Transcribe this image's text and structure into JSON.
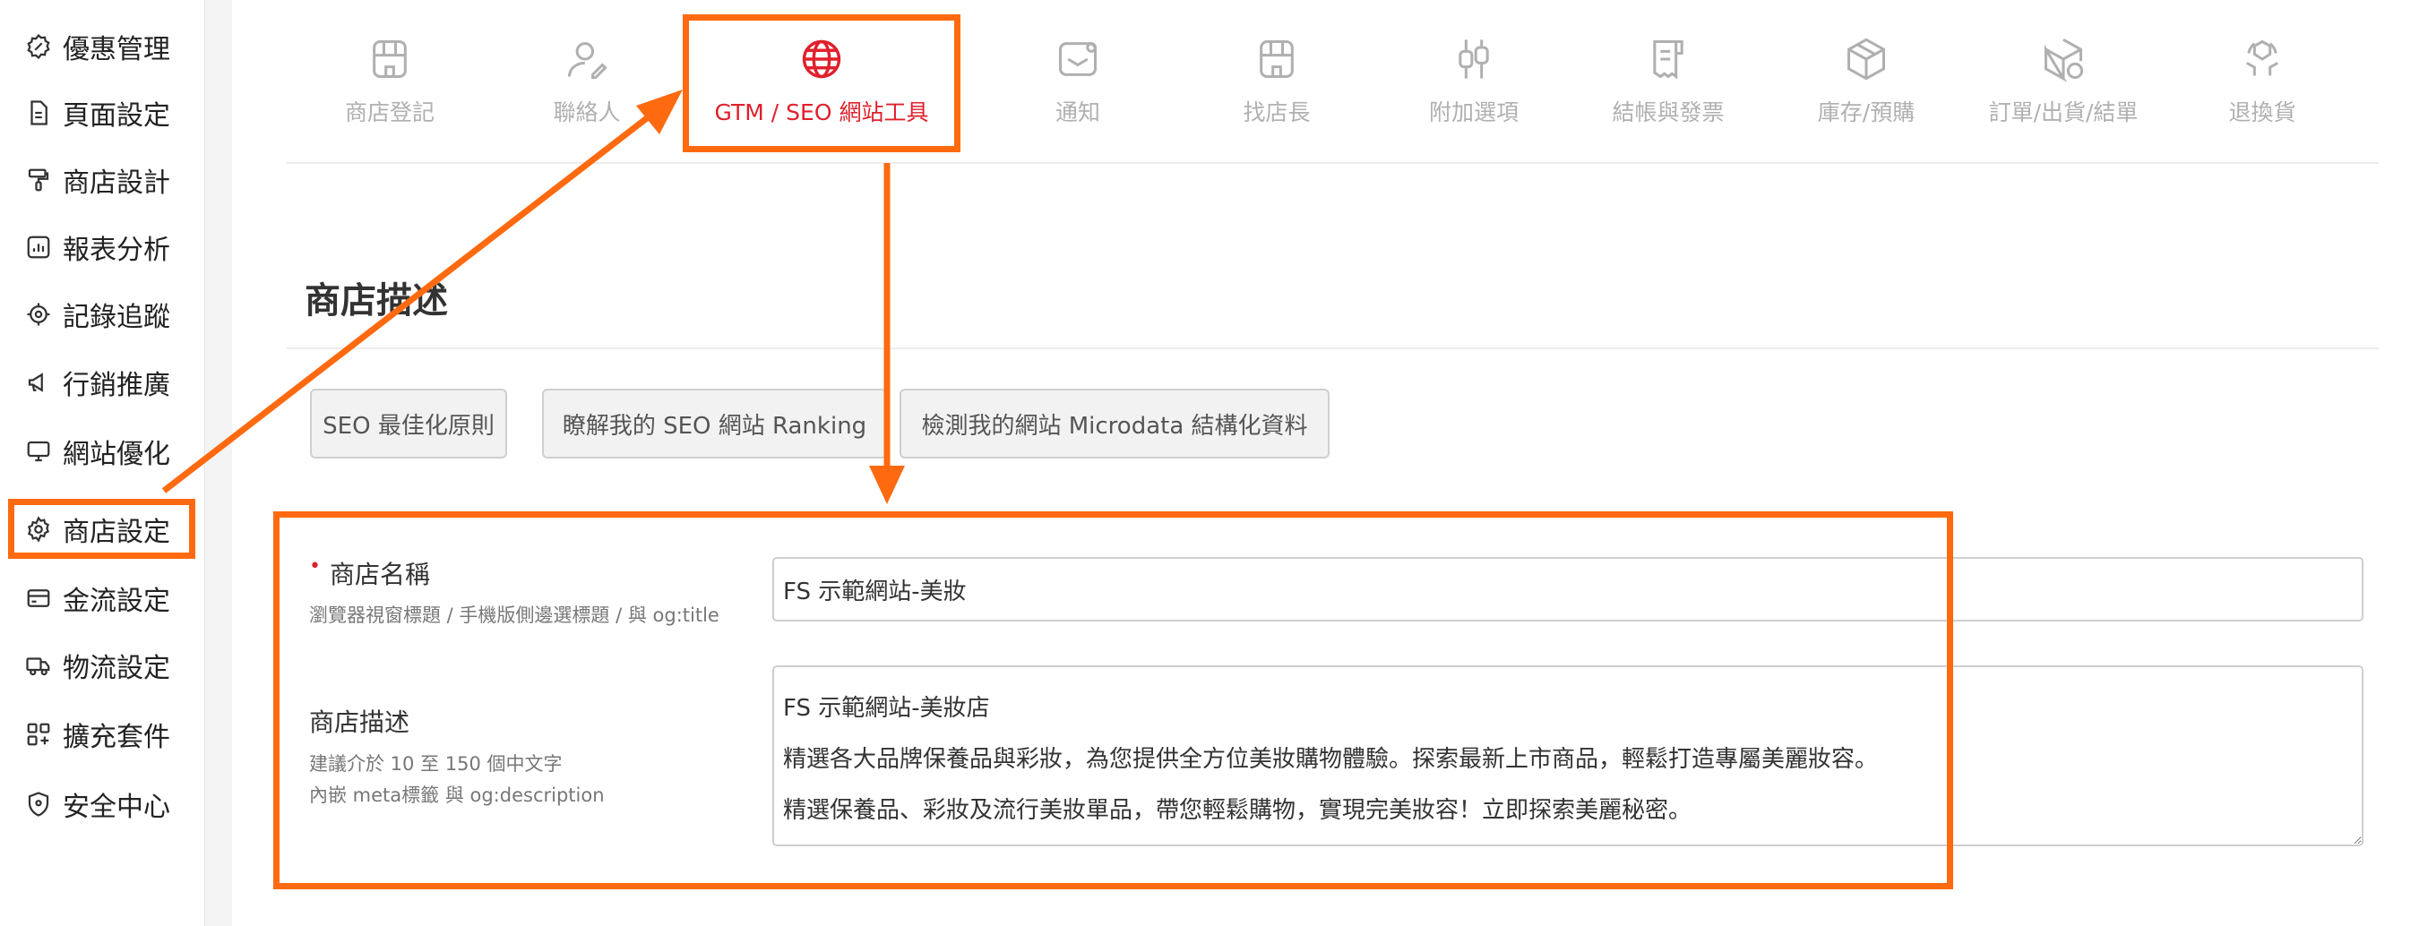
{
  "sidebar": {
    "items": [
      {
        "label": "優惠管理",
        "icon": "discount-badge-icon"
      },
      {
        "label": "頁面設定",
        "icon": "page-icon"
      },
      {
        "label": "商店設計",
        "icon": "paint-roller-icon"
      },
      {
        "label": "報表分析",
        "icon": "chart-icon"
      },
      {
        "label": "記錄追蹤",
        "icon": "target-icon"
      },
      {
        "label": "行銷推廣",
        "icon": "megaphone-icon"
      },
      {
        "label": "網站優化",
        "icon": "monitor-icon"
      },
      {
        "label": "商店設定",
        "icon": "gear-icon",
        "active": true
      },
      {
        "label": "金流設定",
        "icon": "card-icon"
      },
      {
        "label": "物流設定",
        "icon": "truck-icon"
      },
      {
        "label": "擴充套件",
        "icon": "apps-icon"
      },
      {
        "label": "安全中心",
        "icon": "shield-icon"
      }
    ]
  },
  "tabs": [
    {
      "label": "商店登記",
      "icon": "store-icon"
    },
    {
      "label": "聯絡人",
      "icon": "contact-icon"
    },
    {
      "label": "GTM / SEO 網站工具",
      "icon": "globe-icon",
      "active": true
    },
    {
      "label": "通知",
      "icon": "mail-notification-icon"
    },
    {
      "label": "找店長",
      "icon": "store-manager-icon"
    },
    {
      "label": "附加選項",
      "icon": "sliders-icon"
    },
    {
      "label": "結帳與發票",
      "icon": "receipt-icon"
    },
    {
      "label": "庫存/預購",
      "icon": "box-icon"
    },
    {
      "label": "訂單/出貨/結單",
      "icon": "box-check-icon"
    },
    {
      "label": "退換貨",
      "icon": "return-icon"
    }
  ],
  "section": {
    "title": "商店描述"
  },
  "seo_buttons": [
    "SEO 最佳化原則",
    "瞭解我的 SEO 網站 Ranking",
    "檢測我的網站 Microdata 結構化資料"
  ],
  "form": {
    "store_name": {
      "required_mark": "•",
      "label": "商店名稱",
      "hint": "瀏覽器視窗標題 / 手機版側邊選標題 / 與 og:title",
      "value": "FS 示範網站-美妝"
    },
    "store_desc": {
      "label": "商店描述",
      "hint_line1": "建議介於 10 至 150 個中文字",
      "hint_line2": "內嵌 meta標籤 與 og:description",
      "value": "FS 示範網站-美妝店\n精選各大品牌保養品與彩妝，為您提供全方位美妝購物體驗。探索最新上市商品，輕鬆打造專屬美麗妝容。\n精選保養品、彩妝及流行美妝單品，帶您輕鬆購物，實現完美妝容！立即探索美麗秘密。"
    }
  },
  "colors": {
    "annotation": "#ff6a10",
    "accent": "#e0202c",
    "tab_inactive": "#b0b0b0"
  }
}
